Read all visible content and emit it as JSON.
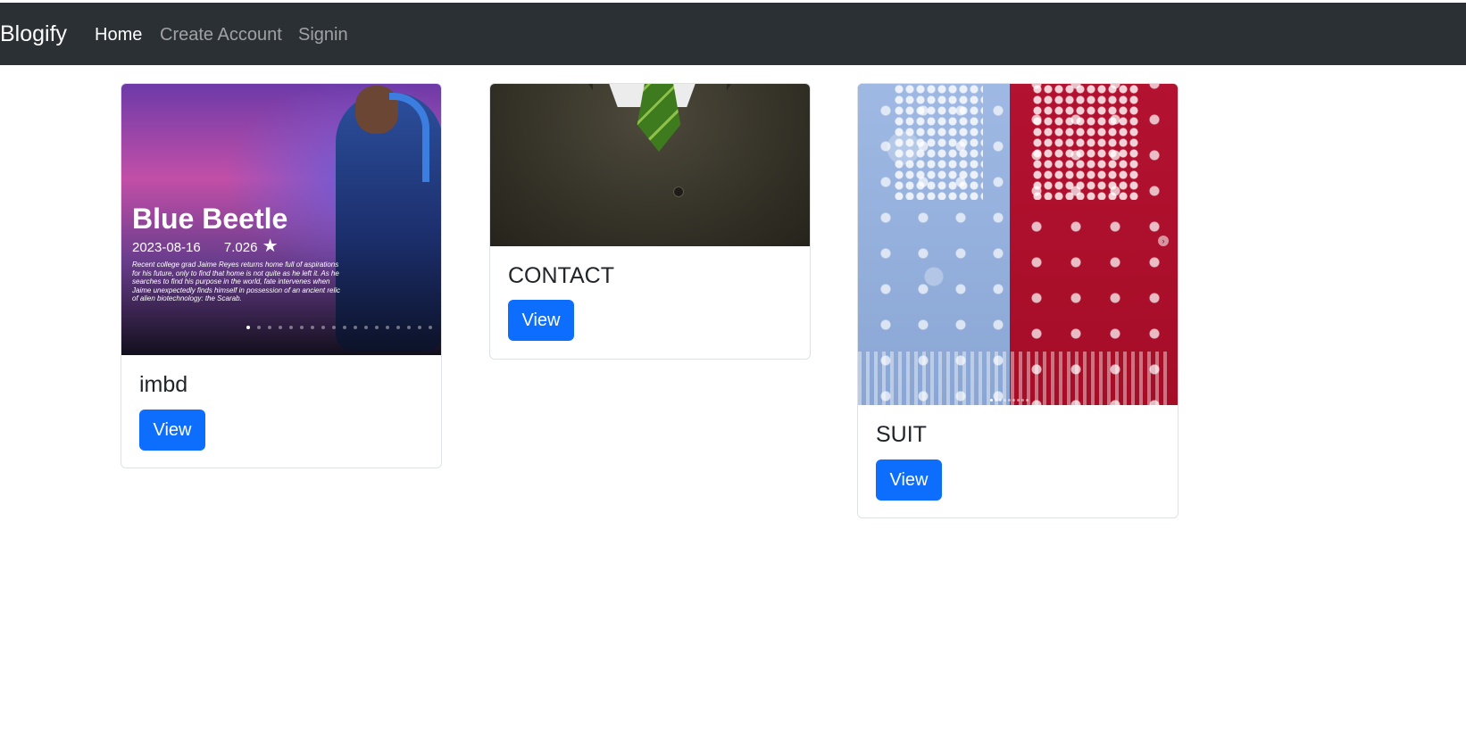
{
  "navbar": {
    "brand": "Blogify",
    "links": [
      {
        "label": "Home",
        "active": true
      },
      {
        "label": "Create Account",
        "active": false
      },
      {
        "label": "Signin",
        "active": false
      }
    ]
  },
  "cards": [
    {
      "title": "imbd",
      "button_label": "View",
      "image": {
        "poster_title": "Blue Beetle",
        "date": "2023-08-16",
        "rating": "7.026",
        "rating_icon": "star-icon",
        "description": "Recent college grad Jaime Reyes returns home full of aspirations for his future, only to find that home is not quite as he left it. As he searches to find his purpose in the world, fate intervenes when Jaime unexpectedly finds himself in possession of an ancient relic of alien biotechnology: the Scarab."
      }
    },
    {
      "title": "CONTACT",
      "button_label": "View"
    },
    {
      "title": "SUIT",
      "button_label": "View"
    }
  ],
  "colors": {
    "navbar_bg": "#2b3035",
    "primary_button": "#0d6efd",
    "card_border": "#dee2e6"
  }
}
